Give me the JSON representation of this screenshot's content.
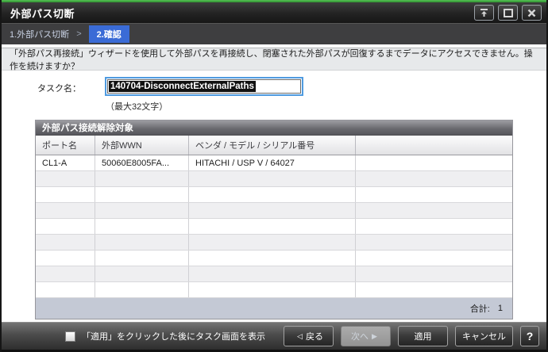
{
  "window": {
    "title": "外部パス切断",
    "controls": {
      "rollup": "roll-up",
      "maximize": "maximize",
      "close": "close"
    }
  },
  "steps": {
    "step1": "1.外部パス切断",
    "separator": ">",
    "step2": "2.確認"
  },
  "warning": "「外部パス再接続」ウィザードを使用して外部パスを再接続し、閉塞された外部パスが回復するまでデータにアクセスできません。操作を続けますか？",
  "task": {
    "label": "タスク名：",
    "value": "140704-DisconnectExternalPaths",
    "note": "（最大32文字）"
  },
  "table": {
    "title": "外部パス接続解除対象",
    "columns": [
      "ポート名",
      "外部WWN",
      "ベンダ / モデル / シリアル番号",
      ""
    ],
    "rows": [
      [
        "CL1-A",
        "50060E8005FA...",
        "HITACHI / USP V / 64027",
        ""
      ]
    ],
    "empty_row_count": 8,
    "total_label": "合計:",
    "total_value": "1"
  },
  "footer": {
    "checkbox_label": "「適用」をクリックした後にタスク画面を表示",
    "checkbox_checked": false,
    "back_label": "戻る",
    "back_arrow": "◁",
    "next_label": "次へ",
    "next_arrow": "▶",
    "next_enabled": false,
    "apply_label": "適用",
    "cancel_label": "キャンセル",
    "help_label": "?"
  },
  "colors": {
    "accent_green": "#3f9e3f",
    "step_active_bg": "#3a6bd6",
    "input_focus_border": "#4f9be0",
    "table_footer_bg": "#c4c9d5"
  }
}
